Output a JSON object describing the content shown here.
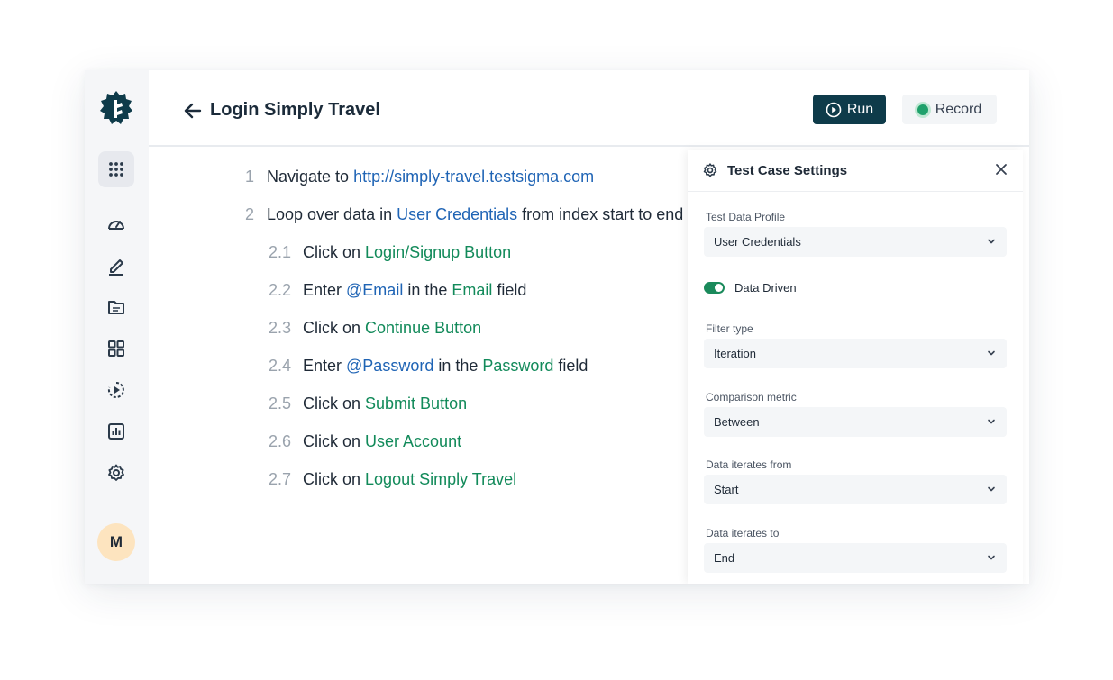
{
  "header": {
    "title": "Login Simply Travel",
    "run_label": "Run",
    "record_label": "Record"
  },
  "sidebar": {
    "avatar_initial": "M",
    "items": [
      {
        "icon": "grid-dots-icon",
        "active": true
      },
      {
        "icon": "dashboard-gauge-icon"
      },
      {
        "icon": "edit-pen-icon"
      },
      {
        "icon": "folder-icon"
      },
      {
        "icon": "apps-grid-icon"
      },
      {
        "icon": "play-circle-icon"
      },
      {
        "icon": "bar-chart-icon"
      },
      {
        "icon": "gear-icon"
      }
    ]
  },
  "steps": [
    {
      "num": "1",
      "parts": [
        {
          "t": "Navigate to "
        },
        {
          "t": "http://simply-travel.testsigma.com",
          "c": "blue"
        }
      ]
    },
    {
      "num": "2",
      "parts": [
        {
          "t": "Loop over data in "
        },
        {
          "t": "User Credentials",
          "c": "blue"
        },
        {
          "t": " from index start to end"
        }
      ]
    },
    {
      "num": "2.1",
      "parts": [
        {
          "t": "Click on "
        },
        {
          "t": "Login/Signup Button",
          "c": "green"
        }
      ]
    },
    {
      "num": "2.2",
      "parts": [
        {
          "t": "Enter "
        },
        {
          "t": "@Email",
          "c": "blue"
        },
        {
          "t": " in the "
        },
        {
          "t": "Email",
          "c": "green"
        },
        {
          "t": " field"
        }
      ]
    },
    {
      "num": "2.3",
      "parts": [
        {
          "t": "Click on "
        },
        {
          "t": "Continue Button",
          "c": "green"
        }
      ]
    },
    {
      "num": "2.4",
      "parts": [
        {
          "t": "Enter "
        },
        {
          "t": "@Password",
          "c": "blue"
        },
        {
          "t": " in the "
        },
        {
          "t": "Password",
          "c": "green"
        },
        {
          "t": " field"
        }
      ]
    },
    {
      "num": "2.5",
      "parts": [
        {
          "t": "Click on "
        },
        {
          "t": "Submit Button",
          "c": "green"
        }
      ]
    },
    {
      "num": "2.6",
      "parts": [
        {
          "t": "Click on "
        },
        {
          "t": "User Account",
          "c": "green"
        }
      ]
    },
    {
      "num": "2.7",
      "parts": [
        {
          "t": "Click on "
        },
        {
          "t": "Logout Simply Travel",
          "c": "green"
        }
      ]
    }
  ],
  "panel": {
    "title": "Test Case Settings",
    "test_data_profile": {
      "label": "Test Data Profile",
      "value": "User Credentials"
    },
    "data_driven": {
      "label": "Data Driven",
      "enabled": true
    },
    "filter_type": {
      "label": "Filter type",
      "value": "Iteration"
    },
    "comparison_metric": {
      "label": "Comparison metric",
      "value": "Between"
    },
    "iterates_from": {
      "label": "Data iterates from",
      "value": "Start"
    },
    "iterates_to": {
      "label": "Data iterates to",
      "value": "End"
    }
  },
  "colors": {
    "brand_dark": "#0e3b4a",
    "link_blue": "#1f64b5",
    "element_green": "#128a5a",
    "record_green": "#1fa16b",
    "avatar_bg": "#fde4bf"
  }
}
